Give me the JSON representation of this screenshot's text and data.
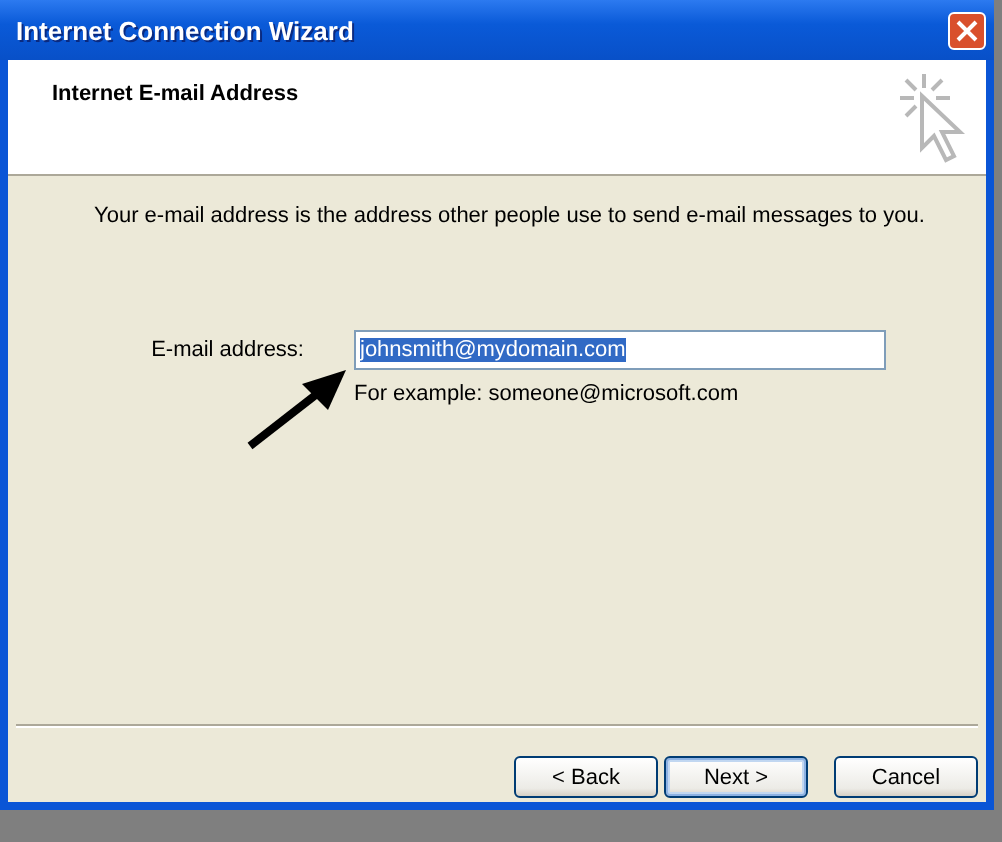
{
  "window": {
    "title": "Internet Connection Wizard"
  },
  "header": {
    "title": "Internet E-mail Address"
  },
  "description": "Your e-mail address is the address other people use to send e-mail messages to you.",
  "email_field": {
    "label": "E-mail address:",
    "value": "johnsmith@mydomain.com",
    "value_selected": true,
    "hint": "For example: someone@microsoft.com"
  },
  "buttons": [
    {
      "label": "< Back",
      "default": false
    },
    {
      "label": "Next >",
      "default": true
    },
    {
      "label": "Cancel",
      "default": false
    }
  ]
}
